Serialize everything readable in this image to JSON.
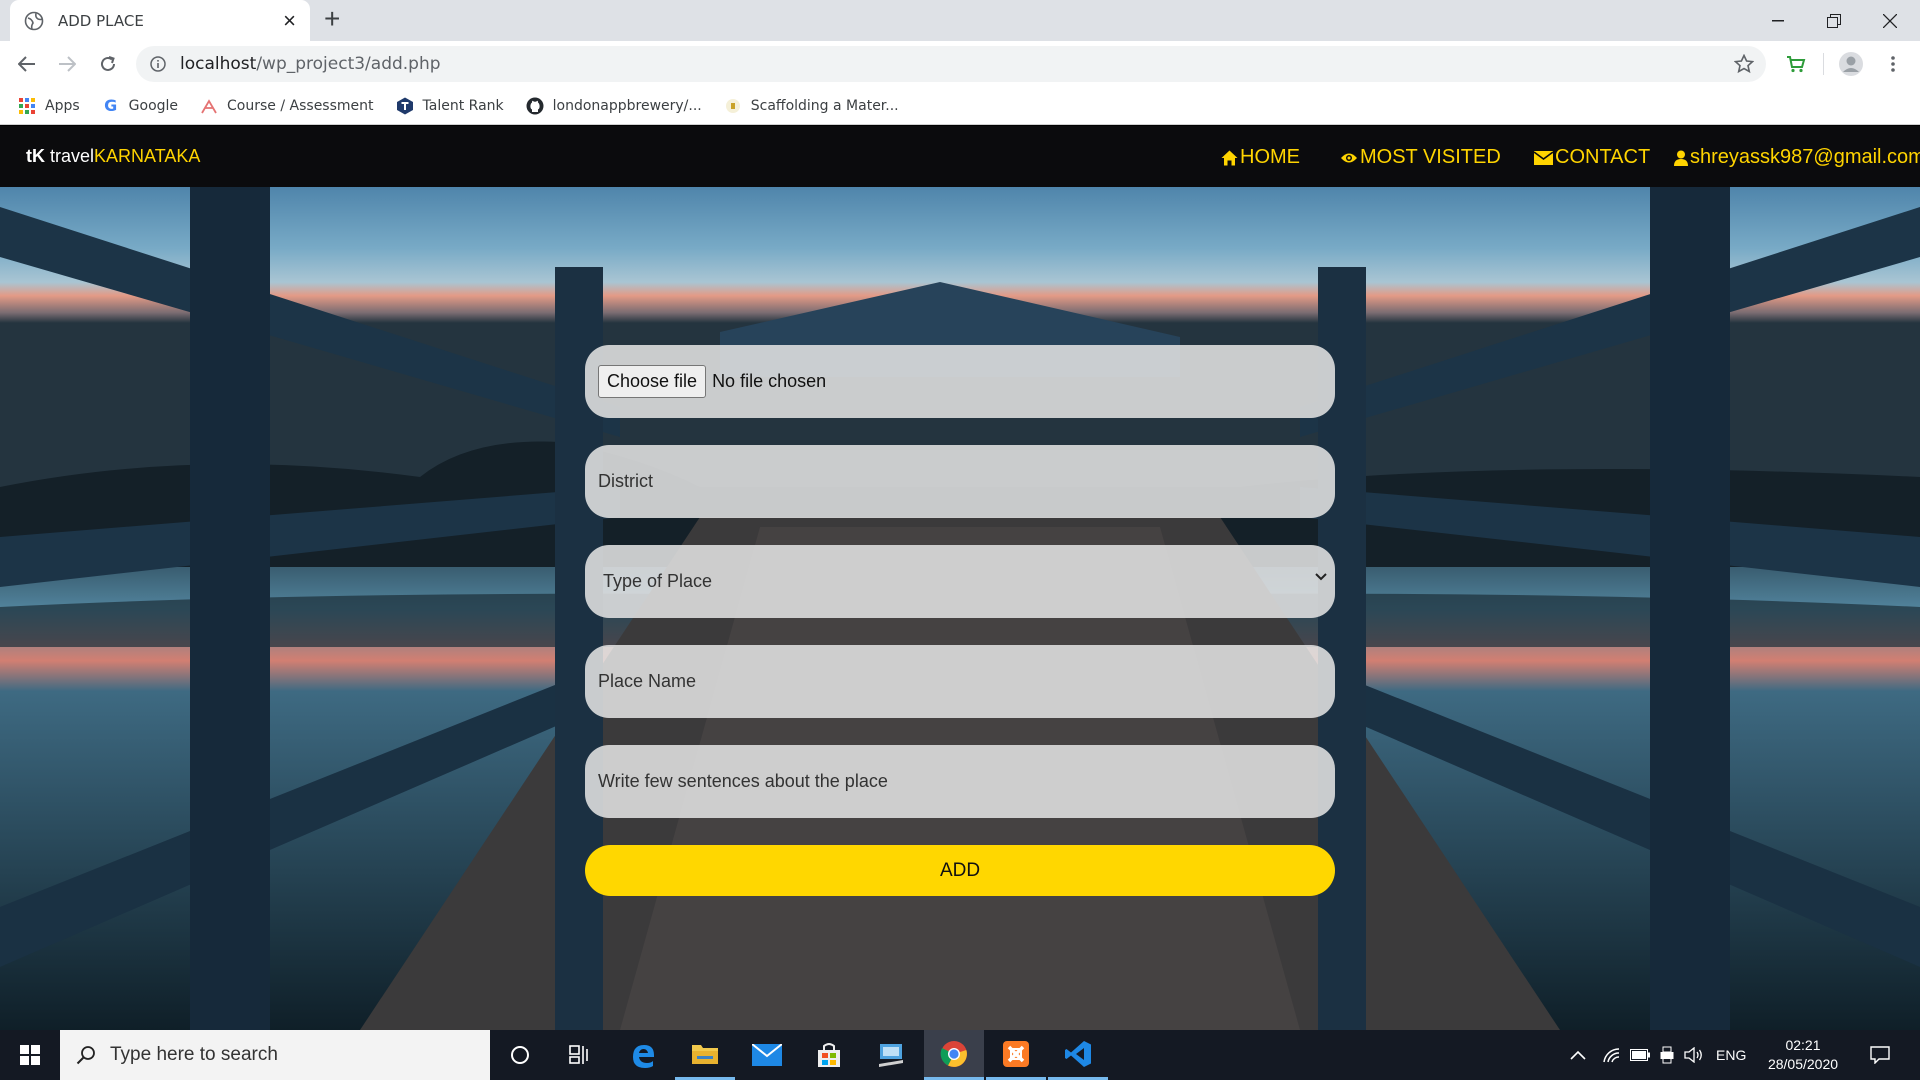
{
  "browser": {
    "tab_title": "ADD PLACE",
    "url_host": "localhost",
    "url_path": "/wp_project3/add.php",
    "bookmarks": [
      {
        "label": "Apps",
        "icon": "apps-grid-icon"
      },
      {
        "label": "Google",
        "icon": "google-icon"
      },
      {
        "label": "Course / Assessment",
        "icon": "course-icon"
      },
      {
        "label": "Talent Rank",
        "icon": "talent-rank-icon"
      },
      {
        "label": "londonappbrewery/...",
        "icon": "github-icon"
      },
      {
        "label": "Scaffolding a Mater...",
        "icon": "scaffolding-icon"
      }
    ]
  },
  "site": {
    "brand_tk": "tK",
    "brand_travel": "travel",
    "brand_karnataka": "KARNATAKA",
    "nav": {
      "home": "HOME",
      "most_visited": "MOST VISITED",
      "contact": "CONTACT",
      "user": "shreyassk987@gmail.com"
    },
    "form": {
      "choose_file": "Choose file",
      "no_file": "No file chosen",
      "district_placeholder": "District",
      "type_of_place": "Type of Place",
      "place_name_placeholder": "Place Name",
      "description_placeholder": "Write few sentences about the place",
      "add_button": "ADD"
    }
  },
  "taskbar": {
    "search_placeholder": "Type here to search",
    "language": "ENG",
    "time": "02:21",
    "date": "28/05/2020"
  },
  "colors": {
    "accent_yellow": "#ffd700",
    "nav_bg": "#0b0b0d",
    "taskbar_bg": "#141923"
  }
}
